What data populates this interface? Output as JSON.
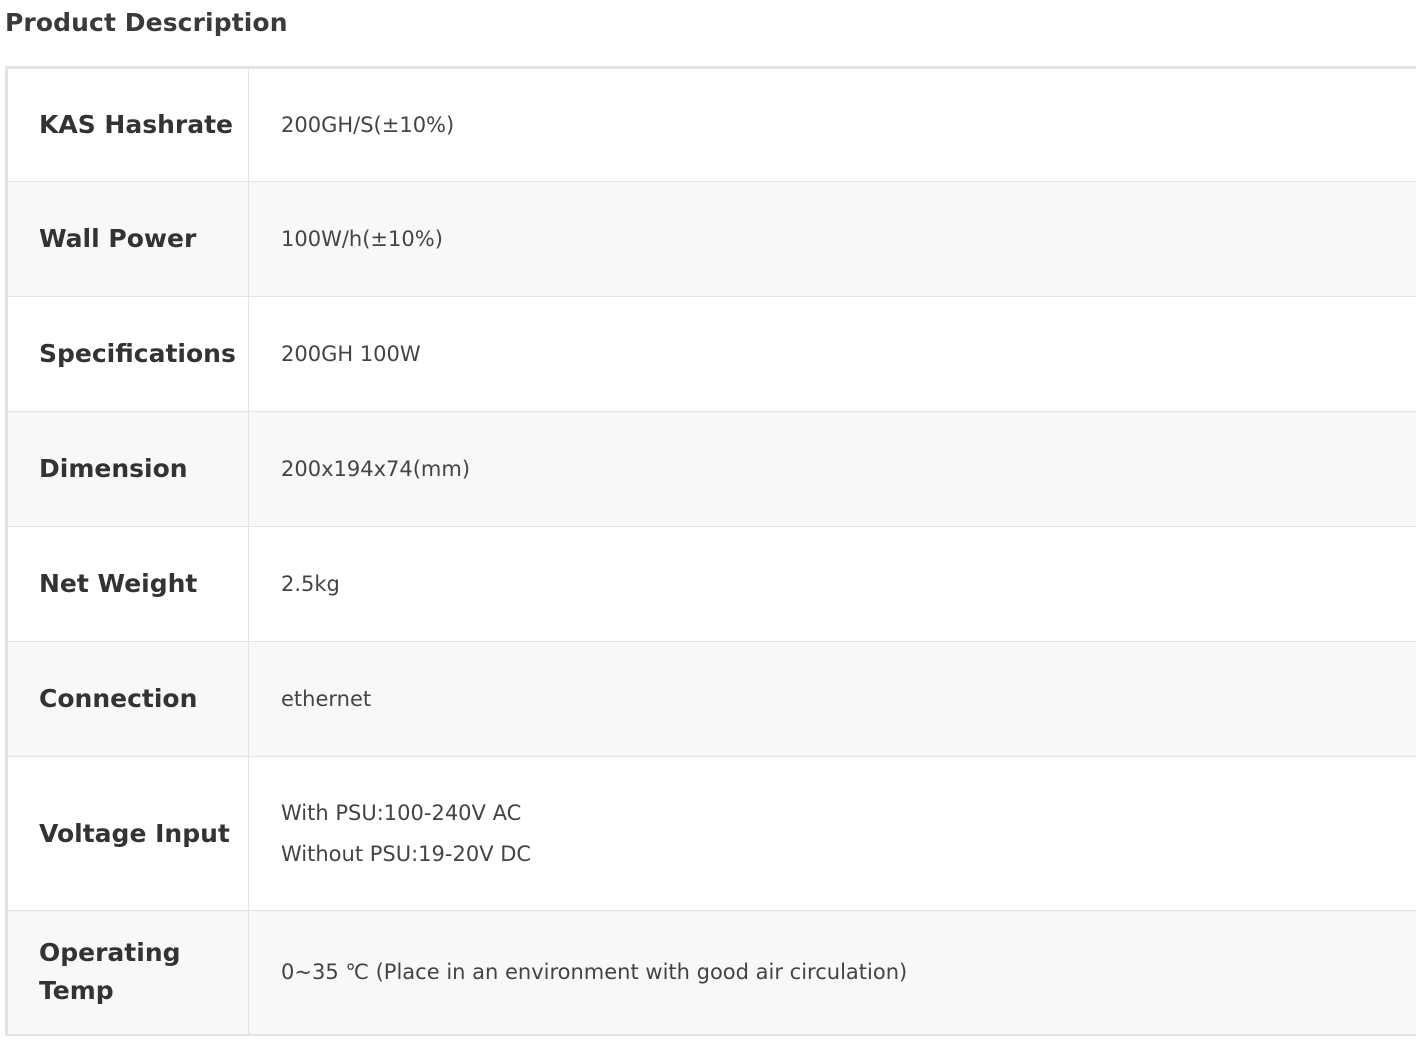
{
  "section": {
    "title": "Product Description"
  },
  "specs": [
    {
      "label": "KAS Hashrate",
      "value": "200GH/S(±10%)"
    },
    {
      "label": "Wall Power",
      "value": "100W/h(±10%)"
    },
    {
      "label": "Specifications",
      "value": "200GH 100W"
    },
    {
      "label": "Dimension",
      "value": "200x194x74(mm)"
    },
    {
      "label": "Net Weight",
      "value": "2.5kg"
    },
    {
      "label": "Connection",
      "value": "ethernet"
    },
    {
      "label": "Voltage Input",
      "value_lines": [
        "With PSU:100-240V AC",
        "Without PSU:19-20V DC"
      ]
    },
    {
      "label": "Operating Temp",
      "value": "0~35 ℃ (Place in an environment with good air circulation)"
    }
  ]
}
